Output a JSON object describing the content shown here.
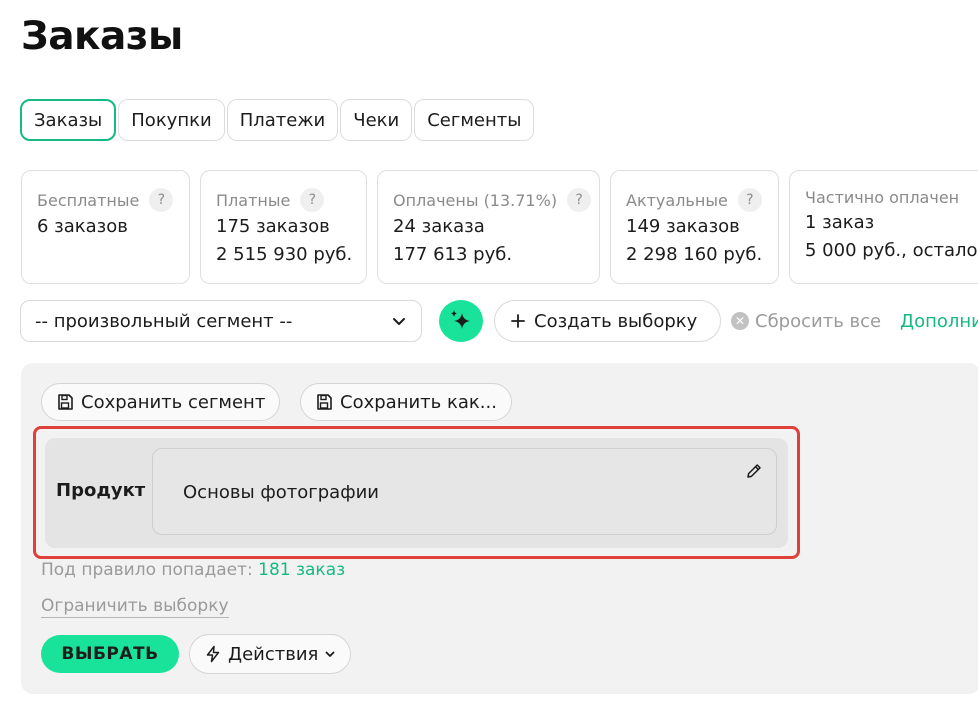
{
  "page": {
    "title": "Заказы"
  },
  "tabs": [
    {
      "label": "Заказы",
      "active": true
    },
    {
      "label": "Покупки"
    },
    {
      "label": "Платежи"
    },
    {
      "label": "Чеки"
    },
    {
      "label": "Сегменты"
    }
  ],
  "stats": [
    {
      "title": "Бесплатные",
      "help": "?",
      "line1": "6 заказов",
      "line2": ""
    },
    {
      "title": "Платные",
      "help": "?",
      "line1": "175 заказов",
      "line2": "2 515 930 руб."
    },
    {
      "title": "Оплачены (13.71%)",
      "help": "?",
      "line1": "24 заказа",
      "line2": "177 613 руб."
    },
    {
      "title": "Актуальные",
      "help": "?",
      "line1": "149 заказов",
      "line2": "2 298 160 руб."
    },
    {
      "title": "Частично оплачен",
      "line1": "1 заказ",
      "line2": "5 000 руб., остало"
    }
  ],
  "filters": {
    "segment_value": "-- произвольный сегмент --",
    "create_label": "Создать выборку",
    "reset_label": "Сбросить все",
    "more_label": "Дополни"
  },
  "panel": {
    "save_segment_label": "Сохранить сегмент",
    "save_as_label": "Сохранить как...",
    "rule": {
      "label": "Продукт",
      "value": "Основы фотографии"
    },
    "match_prefix": "Под правило попадает:",
    "match_count": "181 заказ",
    "limit_label": "Ограничить выборку",
    "select_label": "ВЫБРАТЬ",
    "actions_label": "Действия"
  },
  "colors": {
    "accent": "#19e39a",
    "accent_text": "#16b981",
    "highlight": "#e0403a"
  },
  "icons": {
    "chevron": "chevron-down-icon",
    "sparkle": "sparkle-icon",
    "plus": "plus-icon",
    "clear": "clear-icon",
    "save": "floppy-disk-icon",
    "edit": "pencil-icon",
    "lightning": "lightning-icon"
  }
}
